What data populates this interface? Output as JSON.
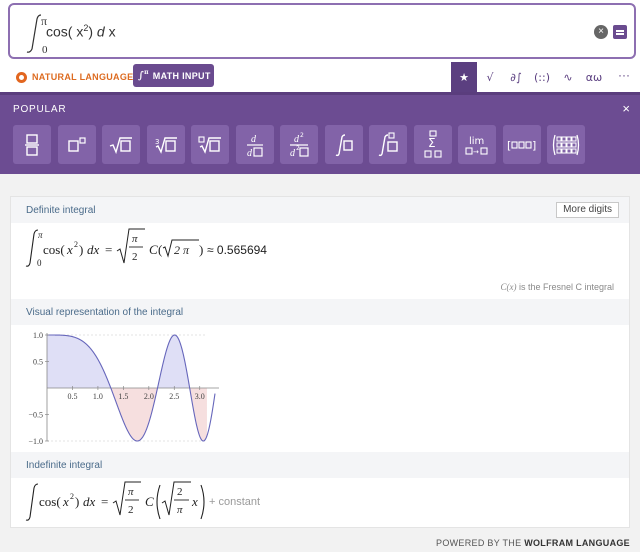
{
  "input": {
    "upper_limit": "π",
    "lower_limit": "0",
    "expr_func": "cos(",
    "expr_var": "x",
    "expr_exp": "2",
    "expr_close": ")",
    "expr_d": "d",
    "expr_dx": "x"
  },
  "modes": {
    "natural_language": "NATURAL LANGUAGE",
    "math_input": "MATH INPUT"
  },
  "tools": [
    "★",
    "√",
    "∂∫",
    "(::)",
    "∿",
    "αω"
  ],
  "tool_names": [
    "favorites-icon",
    "algebra-icon",
    "calculus-icon",
    "matrix-icon",
    "functions-icon",
    "greek-icon"
  ],
  "more": "···",
  "palette": {
    "title": "POPULAR",
    "close": "×",
    "buttons": [
      "fraction",
      "power",
      "sqrt",
      "cube-root",
      "nth-root",
      "derivative",
      "second-derivative",
      "integral",
      "definite-integral",
      "sum",
      "limit",
      "list",
      "matrix"
    ]
  },
  "results": {
    "definite": {
      "title": "Definite integral",
      "more_digits": "More digits",
      "upper": "π",
      "lower": "0",
      "func": "cos(",
      "var": "x",
      "exp": "2",
      "close": ")",
      "dx": "dx",
      "eq": "=",
      "pi": "π",
      "two": "2",
      "c": "C",
      "sqrt_content": "2 π",
      "approx": "≈ 0.565694",
      "note_c": "C(x)",
      "note_text": " is the Fresnel C integral"
    },
    "visual": {
      "title": "Visual representation of the integral"
    },
    "indefinite": {
      "title": "Indefinite integral",
      "func": "cos(",
      "var": "x",
      "exp": "2",
      "close": ")",
      "dx": "dx",
      "eq": "=",
      "pi": "π",
      "two": "2",
      "c": "C",
      "inner_two": "2",
      "inner_pi": "π",
      "inner_x": "x",
      "constant": "+ constant"
    }
  },
  "powered": {
    "prefix": "POWERED BY THE ",
    "brand": "WOLFRAM LANGUAGE"
  },
  "chart_data": {
    "type": "area",
    "function": "cos(x^2)",
    "x_range": [
      0,
      3.3
    ],
    "y_range": [
      -1.0,
      1.0
    ],
    "integration_range": [
      0,
      3.14159
    ],
    "x_ticks": [
      0.5,
      1.0,
      1.5,
      2.0,
      2.5,
      3.0
    ],
    "x_tick_labels": [
      "0.5",
      "1.0",
      "1.5",
      "2.0",
      "2.5",
      "3.0"
    ],
    "y_ticks": [
      -1.0,
      -0.5,
      0.5,
      1.0
    ],
    "y_tick_labels": [
      "−1.0",
      "−0.5",
      "0.5",
      "1.0"
    ],
    "positive_fill": "#dcdcf5",
    "negative_fill": "#f5dcdc",
    "curve_color": "#6666bb"
  },
  "colors": {
    "accent": "#6a4b8f",
    "palette_bg": "#6c4c92",
    "natural_language": "#dd6b20"
  }
}
